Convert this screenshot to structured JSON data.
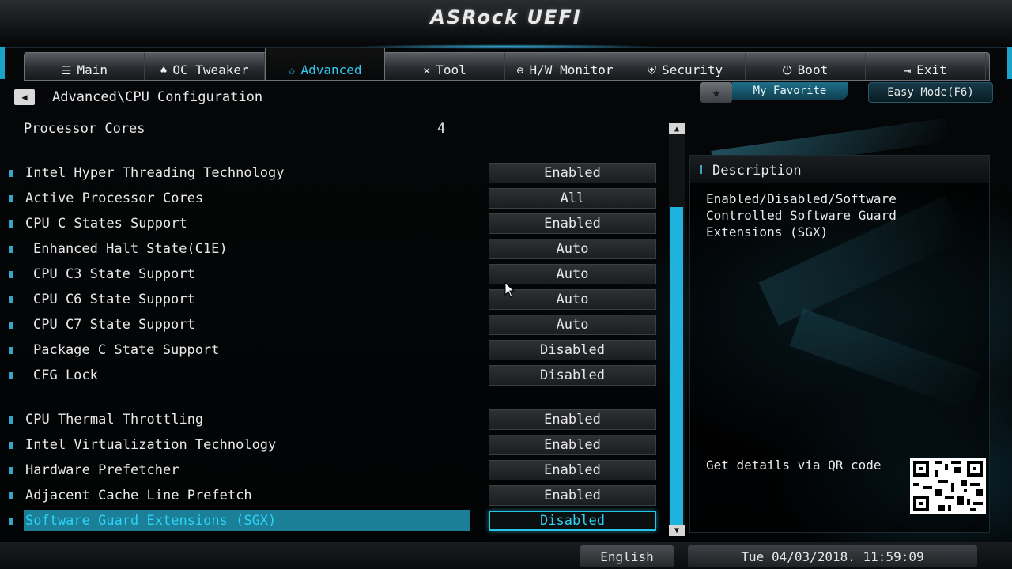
{
  "app_title": "ASRock UEFI",
  "nav_tabs": [
    {
      "label": "Main",
      "icon": "list-icon",
      "glyph": "☰"
    },
    {
      "label": "OC Tweaker",
      "icon": "rocket-icon",
      "glyph": "♠"
    },
    {
      "label": "Advanced",
      "icon": "star-icon",
      "glyph": "✩"
    },
    {
      "label": "Tool",
      "icon": "tools-icon",
      "glyph": "✕"
    },
    {
      "label": "H/W Monitor",
      "icon": "monitor-icon",
      "glyph": "⊖"
    },
    {
      "label": "Security",
      "icon": "shield-icon",
      "glyph": "⛨"
    },
    {
      "label": "Boot",
      "icon": "power-icon",
      "glyph": "⏻"
    },
    {
      "label": "Exit",
      "icon": "exit-icon",
      "glyph": "⇥"
    }
  ],
  "active_tab": "Advanced",
  "breadcrumb": "Advanced\\CPU Configuration",
  "my_favorite": "My Favorite",
  "easy_mode": "Easy Mode(F6)",
  "processor_cores": {
    "label": "Processor Cores",
    "value": "4"
  },
  "settings": [
    {
      "label": "Intel Hyper Threading Technology",
      "value": "Enabled",
      "indent": false
    },
    {
      "label": "Active Processor Cores",
      "value": "All",
      "indent": false
    },
    {
      "label": "CPU C States Support",
      "value": "Enabled",
      "indent": false
    },
    {
      "label": "Enhanced Halt State(C1E)",
      "value": "Auto",
      "indent": true
    },
    {
      "label": "CPU C3 State Support",
      "value": "Auto",
      "indent": true
    },
    {
      "label": "CPU C6 State Support",
      "value": "Auto",
      "indent": true
    },
    {
      "label": "CPU C7 State Support",
      "value": "Auto",
      "indent": true
    },
    {
      "label": "Package C State Support",
      "value": "Disabled",
      "indent": true
    },
    {
      "label": "CFG Lock",
      "value": "Disabled",
      "indent": true
    },
    {
      "label": "CPU Thermal Throttling",
      "value": "Enabled",
      "indent": false
    },
    {
      "label": "Intel Virtualization Technology",
      "value": "Enabled",
      "indent": false
    },
    {
      "label": "Hardware Prefetcher",
      "value": "Enabled",
      "indent": false
    },
    {
      "label": "Adjacent Cache Line Prefetch",
      "value": "Enabled",
      "indent": false
    },
    {
      "label": "Software Guard Extensions (SGX)",
      "value": "Disabled",
      "indent": false,
      "selected": true
    }
  ],
  "description": {
    "title": "Description",
    "text": "Enabled/Disabled/Software Controlled Software Guard Extensions (SGX)",
    "qr_label": "Get details via QR code"
  },
  "footer": {
    "language": "English",
    "datetime": "Tue 04/03/2018. 11:59:09"
  },
  "colors": {
    "accent": "#2fd2f6",
    "selection": "#1a7f97",
    "scroll": "#1eb2dc"
  }
}
